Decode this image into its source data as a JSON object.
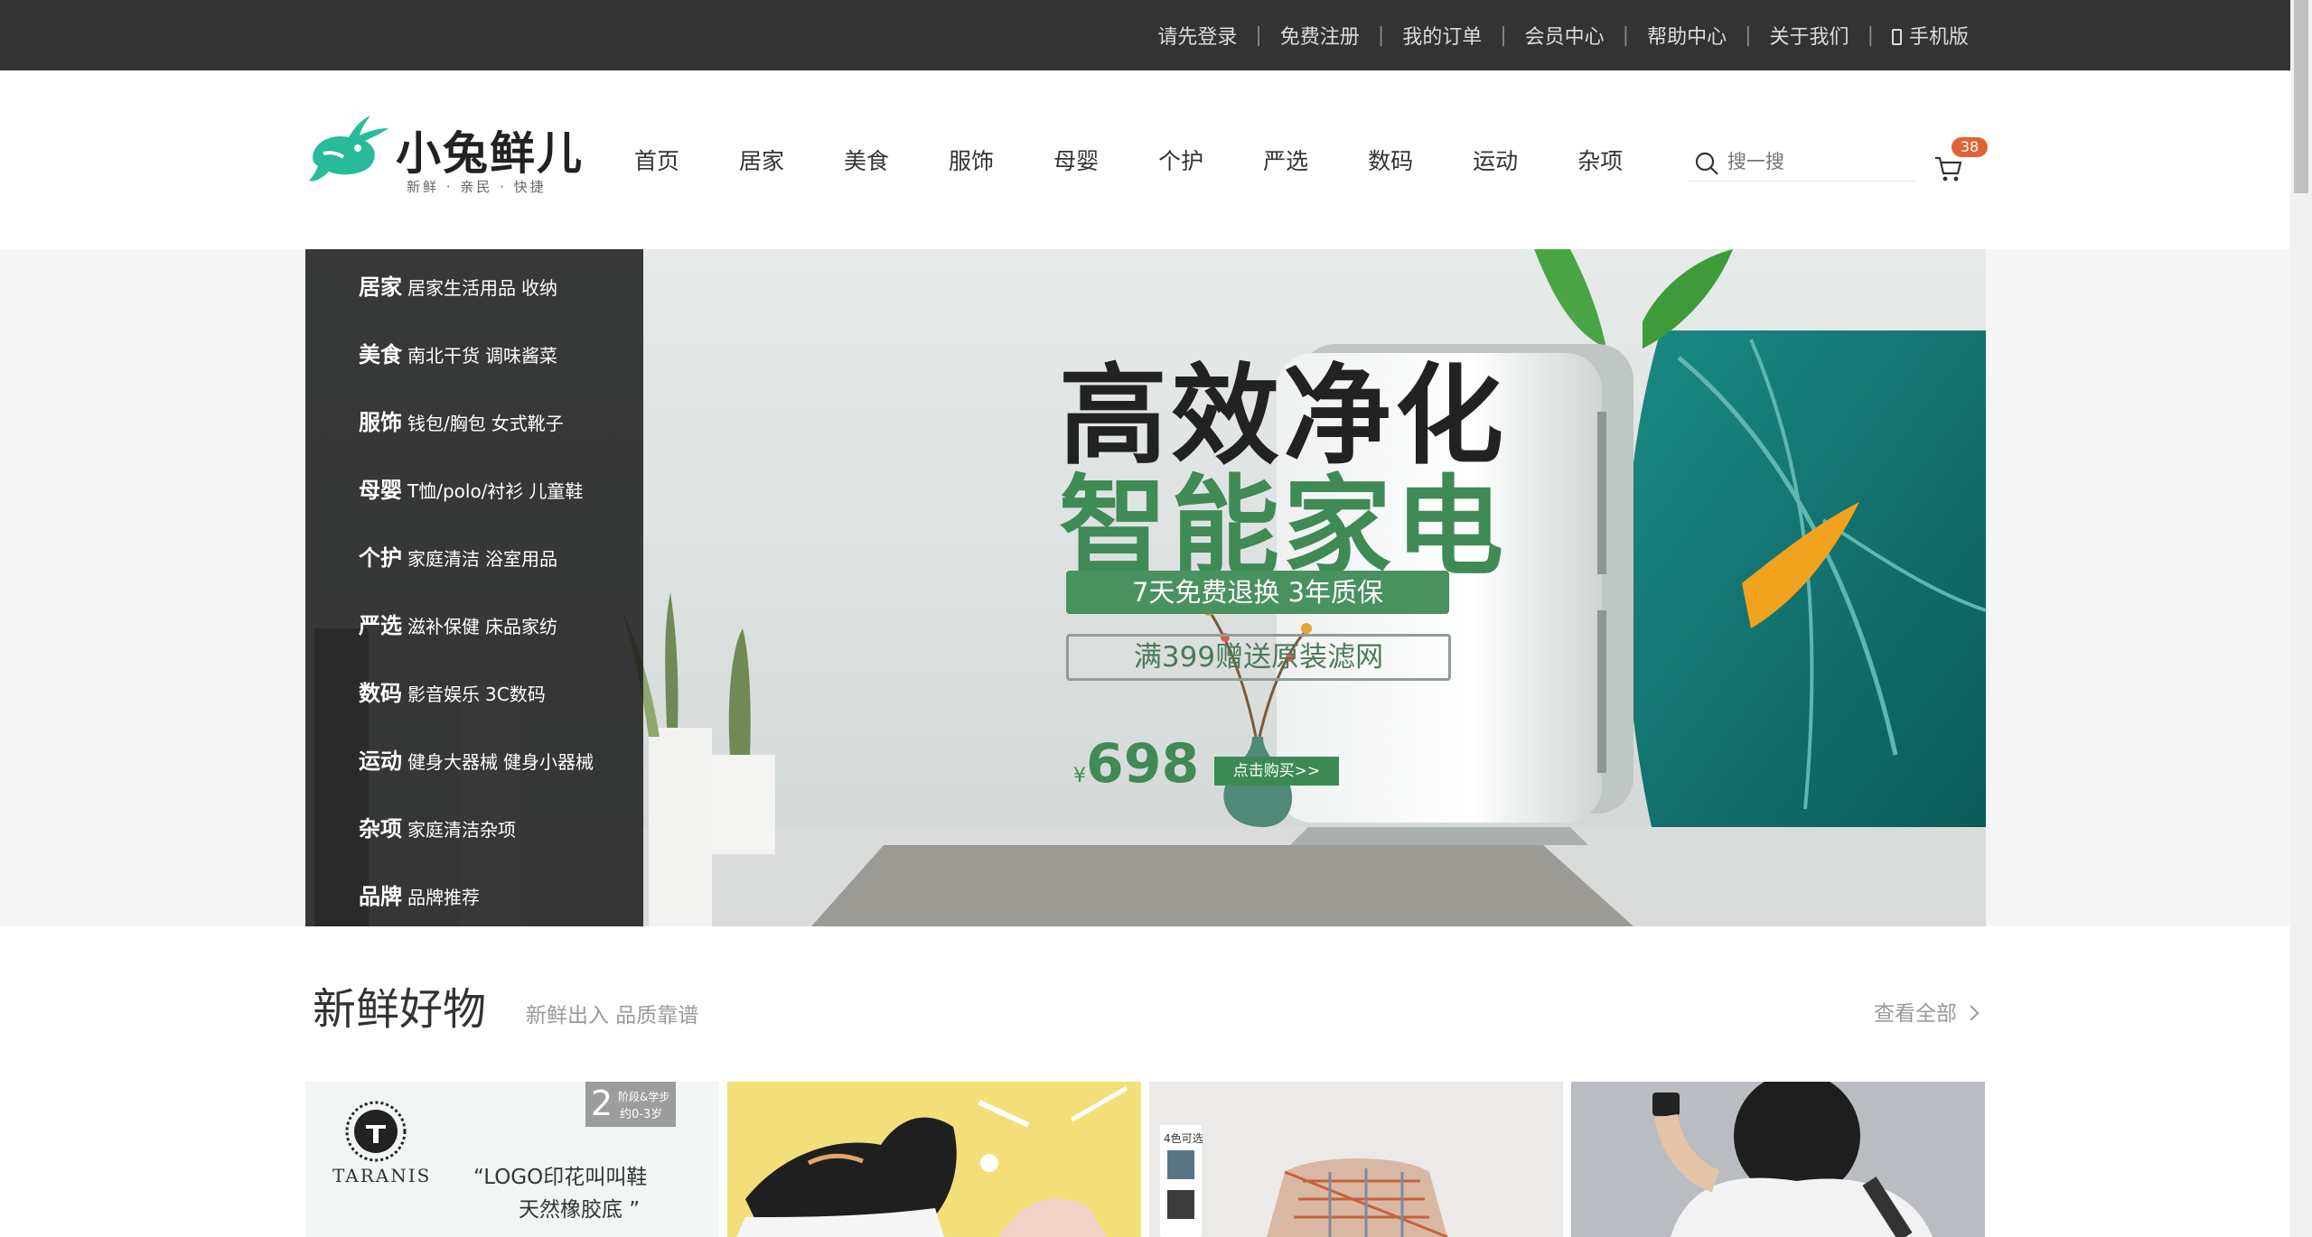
{
  "topbar": {
    "links": [
      "请先登录",
      "免费注册",
      "我的订单",
      "会员中心",
      "帮助中心",
      "关于我们",
      "手机版"
    ]
  },
  "header": {
    "logo_text": "小兔鲜儿",
    "logo_slogan": "新鲜 · 亲民 · 快捷",
    "nav": [
      "首页",
      "居家",
      "美食",
      "服饰",
      "母婴",
      "个护",
      "严选",
      "数码",
      "运动",
      "杂项"
    ],
    "search_placeholder": "搜一搜",
    "cart_count": "38"
  },
  "categories": [
    {
      "name": "居家",
      "subs": [
        "居家生活用品",
        "收纳"
      ]
    },
    {
      "name": "美食",
      "subs": [
        "南北干货",
        "调味酱菜"
      ]
    },
    {
      "name": "服饰",
      "subs": [
        "钱包/胸包",
        "女式靴子"
      ]
    },
    {
      "name": "母婴",
      "subs": [
        "T恤/polo/衬衫",
        "儿童鞋"
      ]
    },
    {
      "name": "个护",
      "subs": [
        "家庭清洁",
        "浴室用品"
      ]
    },
    {
      "name": "严选",
      "subs": [
        "滋补保健",
        "床品家纺"
      ]
    },
    {
      "name": "数码",
      "subs": [
        "影音娱乐",
        "3C数码"
      ]
    },
    {
      "name": "运动",
      "subs": [
        "健身大器械",
        "健身小器械"
      ]
    },
    {
      "name": "杂项",
      "subs": [
        "家庭清洁杂项",
        ""
      ]
    },
    {
      "name": "品牌",
      "subs": [
        "品牌推荐",
        ""
      ]
    }
  ],
  "banner": {
    "headline1": "高效净化",
    "headline2": "智能家电",
    "tag1": "7天免费退换 3年质保",
    "tag2": "满399赠送原装滤网",
    "currency": "¥",
    "price": "698",
    "buy_label": "点击购买>>"
  },
  "section": {
    "title": "新鲜好物",
    "subtitle": "新鲜出入 品质靠谱",
    "more": "查看全部"
  },
  "cards": {
    "brand": "TARANIS",
    "quote1": "“LOGO印花叫叫鞋",
    "quote2": "天然橡胶底 ”",
    "age_num": "2",
    "age_line1": "阶段&学步",
    "age_line2": "约0-3岁",
    "colors_label": "4色可选"
  },
  "colors": {
    "topbar_bg": "#333333",
    "brand_green": "#27ba9b",
    "cart_badge": "#e26237"
  }
}
